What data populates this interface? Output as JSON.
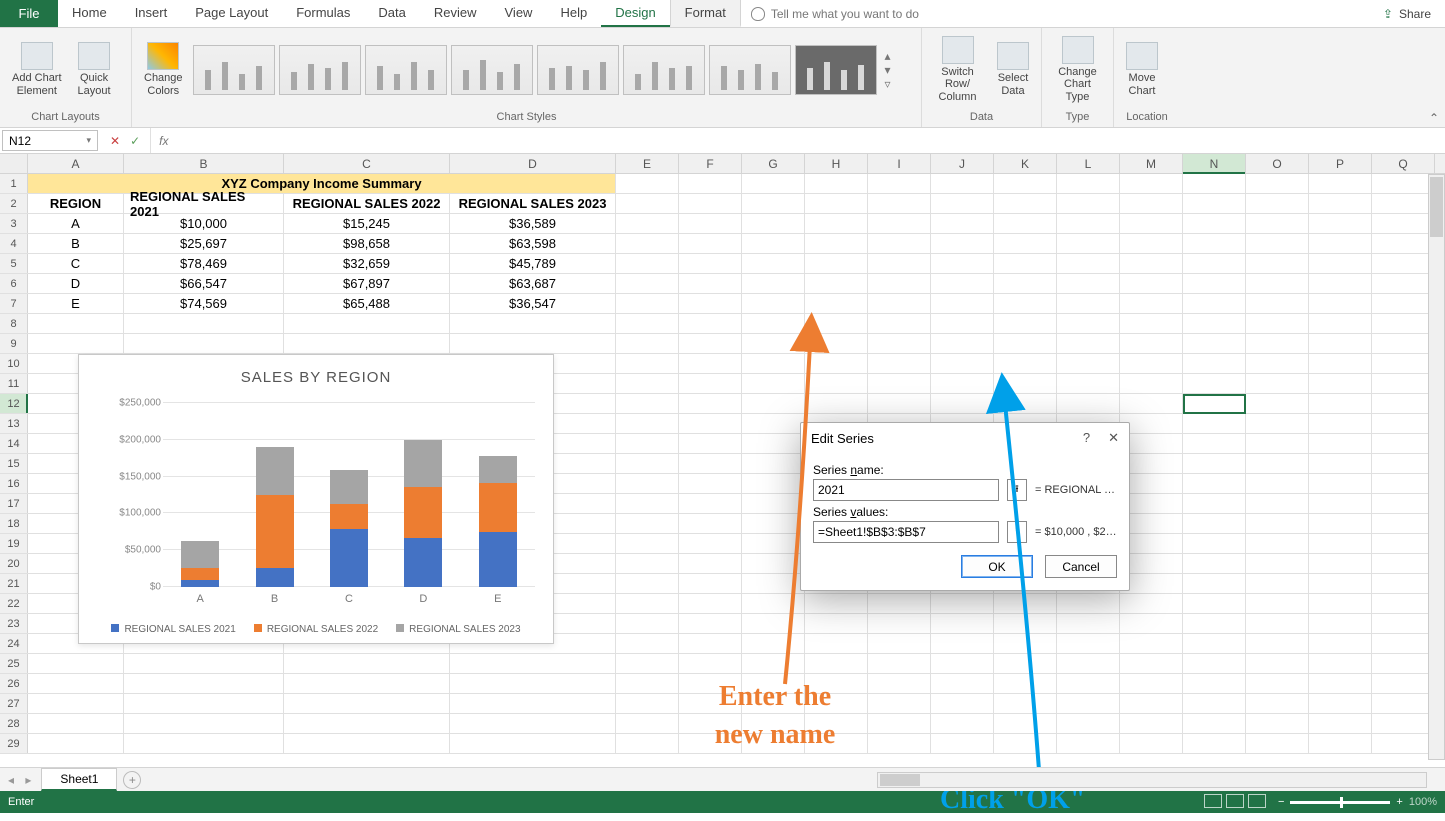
{
  "menu": {
    "file": "File",
    "tabs": [
      "Home",
      "Insert",
      "Page Layout",
      "Formulas",
      "Data",
      "Review",
      "View",
      "Help",
      "Design",
      "Format"
    ],
    "tell": "Tell me what you want to do",
    "share": "Share"
  },
  "ribbon": {
    "groups": {
      "layouts": {
        "label": "Chart Layouts",
        "add": "Add Chart\nElement",
        "quick": "Quick\nLayout"
      },
      "styles": {
        "label": "Chart Styles",
        "change": "Change\nColors"
      },
      "data": {
        "label": "Data",
        "switch": "Switch Row/\nColumn",
        "select": "Select\nData"
      },
      "type": {
        "label": "Type",
        "change": "Change\nChart Type"
      },
      "location": {
        "label": "Location",
        "move": "Move\nChart"
      }
    }
  },
  "formula": {
    "name": "N12",
    "fx": "fx"
  },
  "columns": [
    "A",
    "B",
    "C",
    "D",
    "E",
    "F",
    "G",
    "H",
    "I",
    "J",
    "K",
    "L",
    "M",
    "N",
    "O",
    "P",
    "Q"
  ],
  "sheet": {
    "title": "XYZ Company Income Summary",
    "headers": [
      "REGION",
      "REGIONAL SALES 2021",
      "REGIONAL SALES 2022",
      "REGIONAL SALES 2023"
    ],
    "rows": [
      {
        "r": "A",
        "v": [
          "$10,000",
          "$15,245",
          "$36,589"
        ]
      },
      {
        "r": "B",
        "v": [
          "$25,697",
          "$98,658",
          "$63,598"
        ]
      },
      {
        "r": "C",
        "v": [
          "$78,469",
          "$32,659",
          "$45,789"
        ]
      },
      {
        "r": "D",
        "v": [
          "$66,547",
          "$67,897",
          "$63,687"
        ]
      },
      {
        "r": "E",
        "v": [
          "$74,569",
          "$65,488",
          "$36,547"
        ]
      }
    ]
  },
  "chart_data": {
    "type": "bar",
    "title": "SALES BY REGION",
    "stacked": true,
    "categories": [
      "A",
      "B",
      "C",
      "D",
      "E"
    ],
    "series": [
      {
        "name": "REGIONAL SALES 2021",
        "values": [
          10000,
          25697,
          78469,
          66547,
          74569
        ],
        "color": "#4472c4"
      },
      {
        "name": "REGIONAL SALES 2022",
        "values": [
          15245,
          98658,
          32659,
          67897,
          65488
        ],
        "color": "#ed7d31"
      },
      {
        "name": "REGIONAL SALES 2023",
        "values": [
          36589,
          63598,
          45789,
          63687,
          36547
        ],
        "color": "#a5a5a5"
      }
    ],
    "yticks": [
      "$0",
      "$50,000",
      "$100,000",
      "$150,000",
      "$200,000",
      "$250,000"
    ],
    "ylim": [
      0,
      250000
    ],
    "xlabel": "",
    "ylabel": ""
  },
  "dialog": {
    "title": "Edit Series",
    "series_name_label": "Series name:",
    "series_name_value": "2021",
    "series_name_preview": "= REGIONAL SALES...",
    "series_values_label": "Series values:",
    "series_values_value": "=Sheet1!$B$3:$B$7",
    "series_values_preview": "= $10,000 , $25,...",
    "ok": "OK",
    "cancel": "Cancel",
    "help": "?",
    "close": "✕"
  },
  "annot": {
    "orange": "Enter the\nnew name",
    "blue": "Click \"OK\""
  },
  "sheettab": "Sheet1",
  "status": {
    "mode": "Enter",
    "zoom": "100%"
  }
}
